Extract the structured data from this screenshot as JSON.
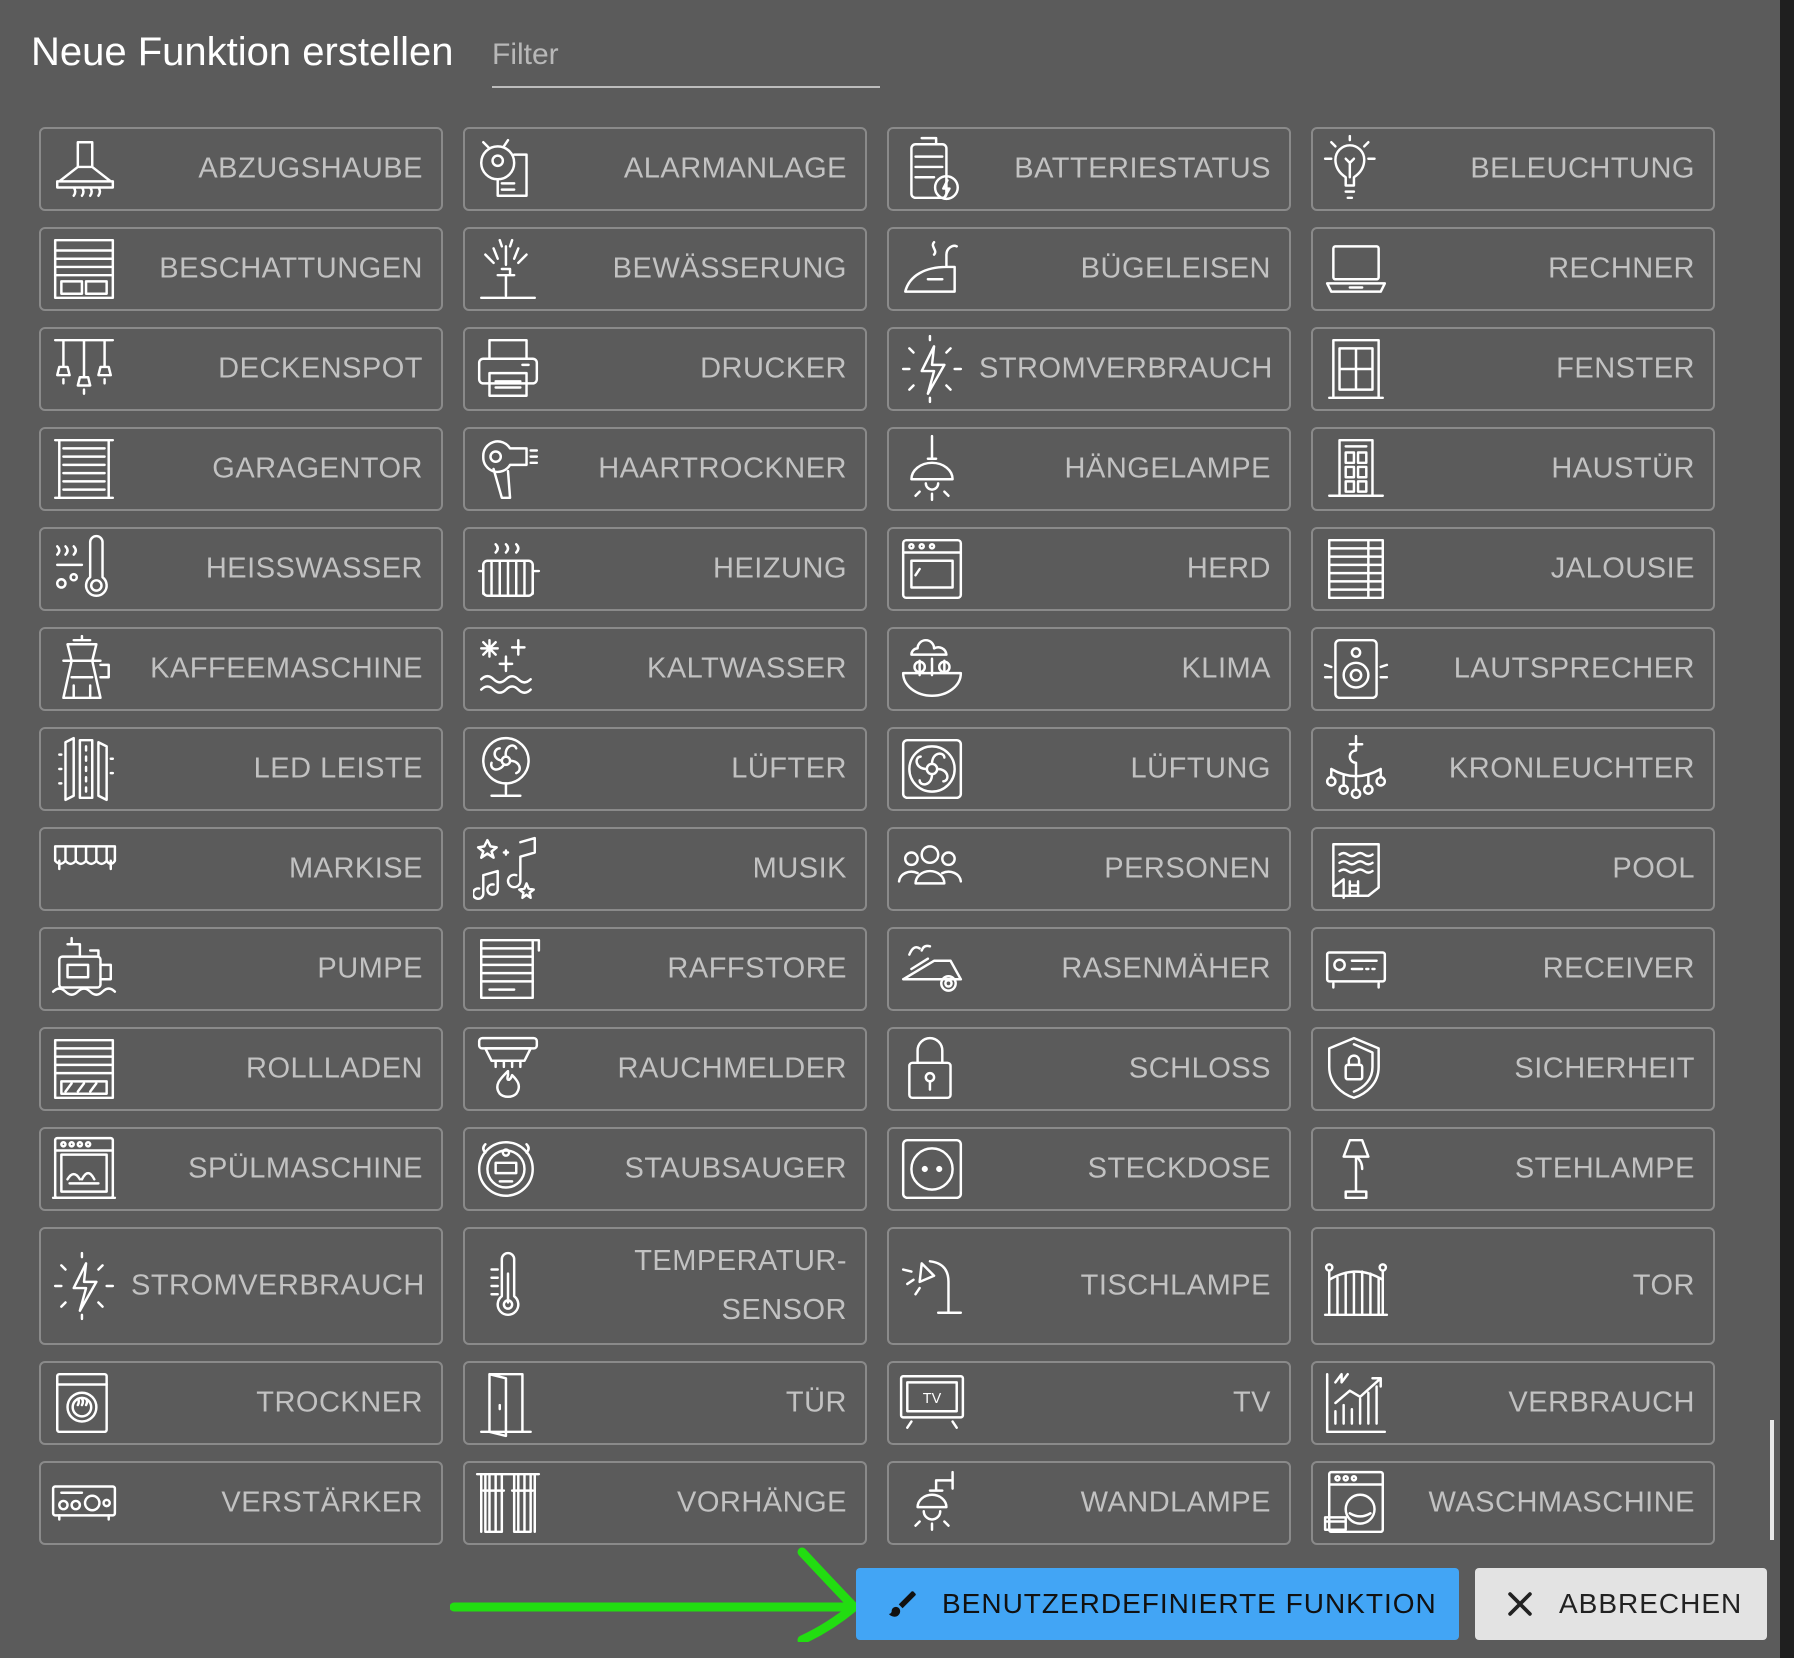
{
  "dialog": {
    "title": "Neue Funktion erstellen",
    "filter_placeholder": "Filter"
  },
  "tiles": [
    {
      "label": "ABZUGSHAUBE",
      "icon": "range-hood-icon"
    },
    {
      "label": "ALARMANLAGE",
      "icon": "alarm-system-icon"
    },
    {
      "label": "BATTERIESTATUS",
      "icon": "battery-status-icon"
    },
    {
      "label": "BELEUCHTUNG",
      "icon": "light-bulb-icon"
    },
    {
      "label": "BESCHATTUNGEN",
      "icon": "shading-icon"
    },
    {
      "label": "BEWÄSSERUNG",
      "icon": "sprinkler-icon"
    },
    {
      "label": "BÜGELEISEN",
      "icon": "iron-icon"
    },
    {
      "label": "RECHNER",
      "icon": "laptop-icon"
    },
    {
      "label": "DECKENSPOT",
      "icon": "ceiling-spot-icon"
    },
    {
      "label": "DRUCKER",
      "icon": "printer-icon"
    },
    {
      "label": "STROMVERBRAUCH",
      "icon": "power-consumption-icon"
    },
    {
      "label": "FENSTER",
      "icon": "window-icon"
    },
    {
      "label": "GARAGENTOR",
      "icon": "garage-door-icon"
    },
    {
      "label": "HAARTROCKNER",
      "icon": "hair-dryer-icon"
    },
    {
      "label": "HÄNGELAMPE",
      "icon": "pendant-lamp-icon"
    },
    {
      "label": "HAUSTÜR",
      "icon": "front-door-icon"
    },
    {
      "label": "HEISSWASSER",
      "icon": "hot-water-icon"
    },
    {
      "label": "HEIZUNG",
      "icon": "radiator-icon"
    },
    {
      "label": "HERD",
      "icon": "oven-icon"
    },
    {
      "label": "JALOUSIE",
      "icon": "blinds-icon"
    },
    {
      "label": "KAFFEEMASCHINE",
      "icon": "coffee-maker-icon"
    },
    {
      "label": "KALTWASSER",
      "icon": "cold-water-icon"
    },
    {
      "label": "KLIMA",
      "icon": "climate-icon"
    },
    {
      "label": "LAUTSPRECHER",
      "icon": "speaker-icon"
    },
    {
      "label": "LED LEISTE",
      "icon": "led-strip-icon"
    },
    {
      "label": "LÜFTER",
      "icon": "fan-icon"
    },
    {
      "label": "LÜFTUNG",
      "icon": "ventilation-icon"
    },
    {
      "label": "KRONLEUCHTER",
      "icon": "chandelier-icon"
    },
    {
      "label": "MARKISE",
      "icon": "awning-icon"
    },
    {
      "label": "MUSIK",
      "icon": "music-icon"
    },
    {
      "label": "PERSONEN",
      "icon": "people-icon"
    },
    {
      "label": "POOL",
      "icon": "pool-icon"
    },
    {
      "label": "PUMPE",
      "icon": "pump-icon"
    },
    {
      "label": "RAFFSTORE",
      "icon": "raffstore-icon"
    },
    {
      "label": "RASENMÄHER",
      "icon": "lawn-mower-icon"
    },
    {
      "label": "RECEIVER",
      "icon": "receiver-icon"
    },
    {
      "label": "ROLLLADEN",
      "icon": "roller-shutter-icon"
    },
    {
      "label": "RAUCHMELDER",
      "icon": "smoke-detector-icon"
    },
    {
      "label": "SCHLOSS",
      "icon": "lock-icon"
    },
    {
      "label": "SICHERHEIT",
      "icon": "security-shield-icon"
    },
    {
      "label": "SPÜLMASCHINE",
      "icon": "dishwasher-icon"
    },
    {
      "label": "STAUBSAUGER",
      "icon": "robot-vacuum-icon"
    },
    {
      "label": "STECKDOSE",
      "icon": "socket-icon"
    },
    {
      "label": "STEHLAMPE",
      "icon": "floor-lamp-icon"
    },
    {
      "label": "STROMVERBRAUCH",
      "icon": "power-consumption-icon"
    },
    {
      "label": "TEMPERATUR-\nSENSOR",
      "icon": "thermometer-icon"
    },
    {
      "label": "TISCHLAMPE",
      "icon": "desk-lamp-icon"
    },
    {
      "label": "TOR",
      "icon": "gate-icon"
    },
    {
      "label": "TROCKNER",
      "icon": "dryer-icon"
    },
    {
      "label": "TÜR",
      "icon": "door-icon"
    },
    {
      "label": "TV",
      "icon": "tv-icon"
    },
    {
      "label": "VERBRAUCH",
      "icon": "consumption-chart-icon"
    },
    {
      "label": "VERSTÄRKER",
      "icon": "amplifier-icon"
    },
    {
      "label": "VORHÄNGE",
      "icon": "curtains-icon"
    },
    {
      "label": "WANDLAMPE",
      "icon": "wall-lamp-icon"
    },
    {
      "label": "WASCHMASCHINE",
      "icon": "washing-machine-icon"
    }
  ],
  "actions": {
    "custom_label": "BENUTZERDEFINIERTE FUNKTION",
    "custom_icon": "paintbrush-icon",
    "cancel_label": "ABBRECHEN",
    "cancel_icon": "close-icon"
  },
  "colors": {
    "background": "#5b5b5b",
    "tile_border": "#8a8a8a",
    "tile_text": "#c2c2c2",
    "primary_button": "#42a5f5",
    "annotation_arrow": "#22dd11"
  }
}
